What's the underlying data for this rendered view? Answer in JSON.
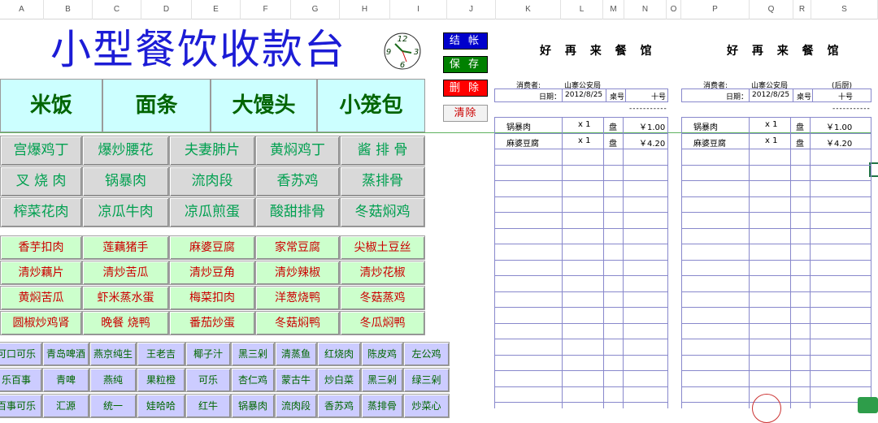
{
  "columns": [
    "A",
    "B",
    "C",
    "D",
    "E",
    "F",
    "G",
    "H",
    "I",
    "J",
    "K",
    "L",
    "M",
    "N",
    "O",
    "P",
    "Q",
    "R",
    "S"
  ],
  "title": "小型餐饮收款台",
  "clock": {
    "n12": "12",
    "n3": "3",
    "n6": "6",
    "n9": "9"
  },
  "actions": {
    "settle": "结 帐",
    "save": "保 存",
    "delete": "删 除",
    "clear": "清除"
  },
  "categories": [
    "米饭",
    "面条",
    "大馒头",
    "小笼包"
  ],
  "dishes": [
    [
      "宫爆鸡丁",
      "爆炒腰花",
      "夫妻肺片",
      "黄焖鸡丁",
      "酱 排 骨"
    ],
    [
      "叉 烧 肉",
      "锅暴肉",
      "流肉段",
      "香苏鸡",
      "蒸排骨"
    ],
    [
      "榨菜花肉",
      "凉瓜牛肉",
      "凉瓜煎蛋",
      "酸甜排骨",
      "冬菇焖鸡"
    ]
  ],
  "veg_dishes": [
    [
      "香芋扣肉",
      "莲藕猪手",
      "麻婆豆腐",
      "家常豆腐",
      "尖椒土豆丝"
    ],
    [
      "清炒藕片",
      "清炒苦瓜",
      "清炒豆角",
      "清炒辣椒",
      "清炒花椒"
    ],
    [
      "黄焖苦瓜",
      "虾米蒸水蛋",
      "梅菜扣肉",
      "洋葱烧鸭",
      "冬菇蒸鸡"
    ],
    [
      "圆椒炒鸡肾",
      "晚餐 烧鸭",
      "番茄炒蛋",
      "冬菇焖鸭",
      "冬瓜焖鸭"
    ]
  ],
  "drinks": [
    [
      "可口可乐",
      "青岛啤酒",
      "燕京纯生",
      "王老吉",
      "椰子汁",
      "黑三剁",
      "清蒸鱼",
      "红烧肉",
      "陈皮鸡",
      "左公鸡"
    ],
    [
      "乐百事",
      "青啤",
      "燕纯",
      "果粒橙",
      "可乐",
      "杏仁鸡",
      "蒙古牛",
      "炒白菜",
      "黑三剁",
      "绿三剁"
    ],
    [
      "百事可乐",
      "汇源",
      "统一",
      "娃哈哈",
      "红牛",
      "锅暴肉",
      "流肉段",
      "香苏鸡",
      "蒸排骨",
      "炒菜心"
    ]
  ],
  "receipt1": {
    "title": "好 再 来 餐 馆",
    "customer_label": "消费者:",
    "customer": "山寨公安局",
    "date_label": "日期：",
    "date": "2012/8/25",
    "table_label": "桌号",
    "table": "十号",
    "dashes": "-----------",
    "items": [
      {
        "name": "锅暴肉",
        "qty": "x 1",
        "unit": "盘",
        "price": "￥1.00"
      },
      {
        "name": "麻婆豆腐",
        "qty": "x 1",
        "unit": "盘",
        "price": "￥4.20"
      }
    ]
  },
  "receipt2": {
    "title": "好 再 来 餐 馆",
    "customer_label": "消费者:",
    "customer": "山寨公安局",
    "kitchen": "(后厨)",
    "date_label": "日期：",
    "date": "2012/8/25",
    "table_label": "桌号",
    "table": "十号",
    "dashes": "-----------",
    "items": [
      {
        "name": "锅暴肉",
        "qty": "x 1",
        "unit": "盘",
        "price": "￥1.00"
      },
      {
        "name": "麻婆豆腐",
        "qty": "x 1",
        "unit": "盘",
        "price": "￥4.20"
      }
    ]
  },
  "colors": {
    "title": "#1c1cd6",
    "category_bg": "#ccffff",
    "dish_text": "#00a050",
    "veg_bg": "#ccffcc",
    "veg_text": "#cc0000",
    "drink_bg": "#ccccff",
    "grid": "#8888cc"
  }
}
